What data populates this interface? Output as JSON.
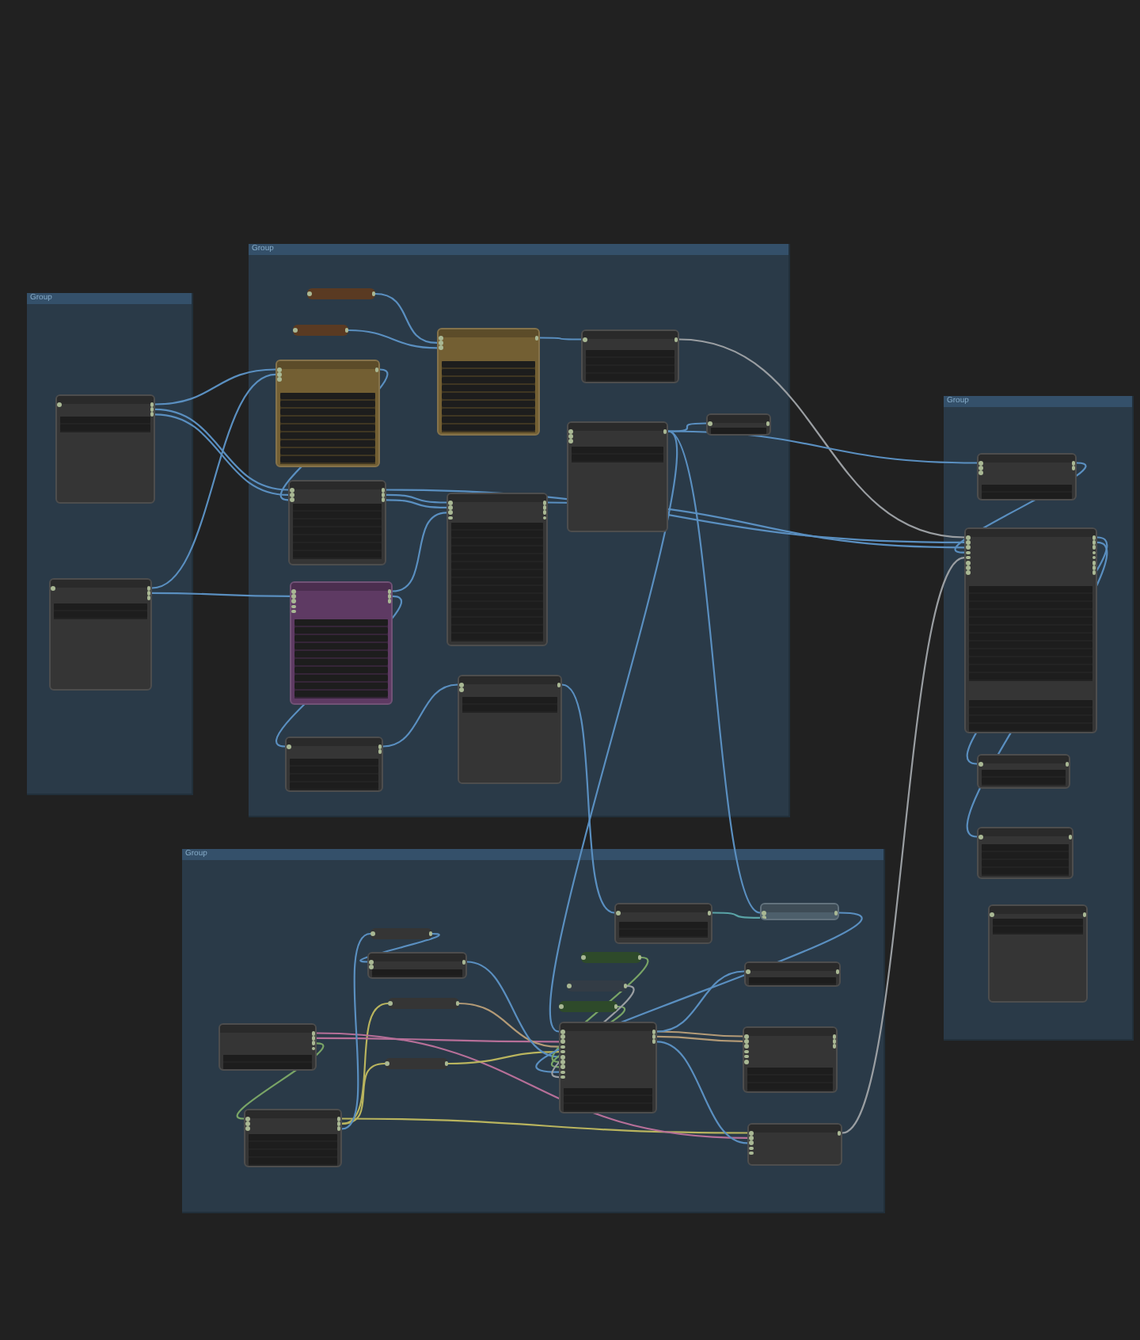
{
  "groups": [
    {
      "title": "Group",
      "nodes": [
        {
          "kind": "node",
          "color": "#353535"
        },
        {
          "kind": "node",
          "color": "#353535"
        }
      ]
    },
    {
      "title": "Group",
      "nodes": [
        {
          "kind": "collapsed",
          "color": "#5a3a22"
        },
        {
          "kind": "collapsed",
          "color": "#5a3a22"
        },
        {
          "kind": "node",
          "color": "#735f33"
        },
        {
          "kind": "node",
          "color": "#735f33"
        },
        {
          "kind": "node",
          "color": "#353535"
        },
        {
          "kind": "node",
          "color": "#353535"
        },
        {
          "kind": "node",
          "color": "#353535"
        },
        {
          "kind": "node",
          "color": "#353535"
        },
        {
          "kind": "node",
          "color": "#353535"
        },
        {
          "kind": "node",
          "color": "#5e3a63"
        },
        {
          "kind": "node",
          "color": "#353535"
        },
        {
          "kind": "node",
          "color": "#353535"
        }
      ]
    },
    {
      "title": "Group",
      "nodes": [
        {
          "kind": "node",
          "color": "#353535"
        },
        {
          "kind": "node",
          "color": "#353535"
        },
        {
          "kind": "node",
          "color": "#353535"
        },
        {
          "kind": "node",
          "color": "#353535"
        },
        {
          "kind": "node",
          "color": "#353535"
        }
      ]
    },
    {
      "title": "Group",
      "nodes": [
        {
          "kind": "collapsed",
          "color": "#353535"
        },
        {
          "kind": "node",
          "color": "#353535"
        },
        {
          "kind": "collapsed",
          "color": "#353535"
        },
        {
          "kind": "node",
          "color": "#353535"
        },
        {
          "kind": "collapsed",
          "color": "#353535"
        },
        {
          "kind": "node",
          "color": "#353535"
        },
        {
          "kind": "node",
          "color": "#353535"
        },
        {
          "kind": "node",
          "color": "#4d5f6b"
        },
        {
          "kind": "collapsed",
          "color": "#2e4a2a"
        },
        {
          "kind": "collapsed",
          "color": "#333c45"
        },
        {
          "kind": "collapsed",
          "color": "#2e4a2a"
        },
        {
          "kind": "node",
          "color": "#353535"
        },
        {
          "kind": "node",
          "color": "#353535"
        },
        {
          "kind": "node",
          "color": "#353535"
        },
        {
          "kind": "node",
          "color": "#353535"
        }
      ]
    }
  ],
  "wires": [
    {
      "color": "#5a8fc0"
    },
    {
      "color": "#5a8fc0"
    },
    {
      "color": "#5a8fc0"
    },
    {
      "color": "#5a8fc0"
    },
    {
      "color": "#5a8fc0"
    },
    {
      "color": "#5a8fc0"
    },
    {
      "color": "#5a8fc0"
    },
    {
      "color": "#5a8fc0"
    },
    {
      "color": "#5a8fc0"
    },
    {
      "color": "#5a8fc0"
    },
    {
      "color": "#5a8fc0"
    },
    {
      "color": "#9a9ea2"
    },
    {
      "color": "#5a8fc0"
    },
    {
      "color": "#5a8fc0"
    },
    {
      "color": "#5a8fc0"
    },
    {
      "color": "#5a8fc0"
    },
    {
      "color": "#5a8fc0"
    },
    {
      "color": "#5a8fc0"
    },
    {
      "color": "#5a8fc0"
    },
    {
      "color": "#5a8fc0"
    },
    {
      "color": "#5a8fc0"
    },
    {
      "color": "#9a9ea2"
    },
    {
      "color": "#b9b45e"
    },
    {
      "color": "#b9b45e"
    },
    {
      "color": "#b9b45e"
    },
    {
      "color": "#b66f98"
    },
    {
      "color": "#b66f98"
    },
    {
      "color": "#b39a76"
    },
    {
      "color": "#b9b45e"
    },
    {
      "color": "#b39a76"
    },
    {
      "color": "#b39a76"
    },
    {
      "color": "#5a8fc0"
    },
    {
      "color": "#5a8fc0"
    },
    {
      "color": "#79a466"
    },
    {
      "color": "#79a466"
    },
    {
      "color": "#5a8fc0"
    },
    {
      "color": "#5aa3a6"
    },
    {
      "color": "#5a8fc0"
    },
    {
      "color": "#5a8fc0"
    },
    {
      "color": "#5a8fc0"
    },
    {
      "color": "#79a466"
    },
    {
      "color": "#5a8fc0"
    },
    {
      "color": "#5a8fc0"
    },
    {
      "color": "#9a9ea2"
    },
    {
      "color": "#5a8fc0"
    },
    {
      "color": "#5a8fc0"
    }
  ]
}
